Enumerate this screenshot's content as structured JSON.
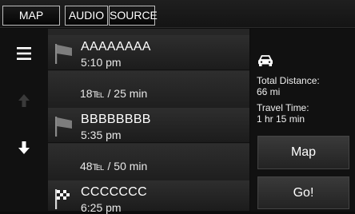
{
  "tabs": [
    {
      "label": "MAP"
    },
    {
      "label": "AUDIO"
    },
    {
      "label": "SOURCE"
    }
  ],
  "controls": {
    "menu_icon": "hamburger-menu-icon",
    "up_icon": "arrow-up-icon",
    "down_icon": "arrow-down-icon"
  },
  "stops": [
    {
      "name": "AAAAAAAA",
      "time": "5:10 pm",
      "icon": "flag-icon"
    },
    {
      "name": "BBBBBBBB",
      "time": "5:35 pm",
      "icon": "flag-icon"
    },
    {
      "name": "CCCCCCC",
      "time": "6:25 pm",
      "icon": "checkered-flag-icon"
    }
  ],
  "legs": [
    {
      "text": "18℡ / 25 min"
    },
    {
      "text": "48℡ / 50 min"
    }
  ],
  "summary": {
    "icon": "car-icon",
    "distance_label": "Total Distance:",
    "distance_value": "66 mi",
    "time_label": "Travel Time:",
    "time_value": "1 hr 15 min"
  },
  "buttons": {
    "map_label": "Map",
    "go_label": "Go!"
  },
  "colors": {
    "background": "#0c0c0c",
    "row": "#2a2a2a",
    "text": "#ffffff",
    "disabled_icon": "#3a3a3a"
  }
}
